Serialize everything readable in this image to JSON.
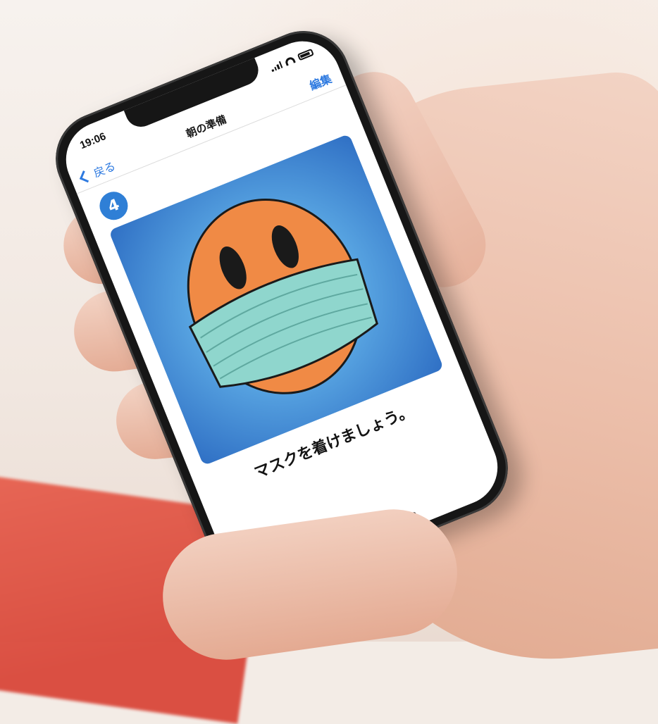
{
  "status_bar": {
    "time": "19:06",
    "icons": [
      "cellular-signal-icon",
      "wifi-icon",
      "battery-icon"
    ]
  },
  "nav": {
    "back_label": "戻る",
    "title": "朝の準備",
    "edit_label": "編集"
  },
  "step": {
    "number": "4",
    "caption": "マスクを着けましょう。"
  },
  "illustration": {
    "icon": "masked-face-icon",
    "colors": {
      "background": "#4f9ee0",
      "face": "#f08a45",
      "mask": "#8fd6cd"
    }
  },
  "colors": {
    "accent": "#2e7ae0",
    "badge": "#2f7fd6"
  }
}
